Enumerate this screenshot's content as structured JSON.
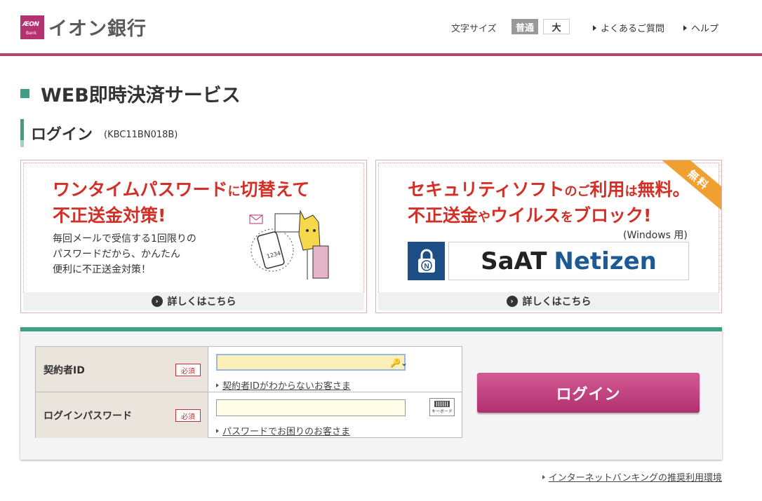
{
  "header": {
    "logo_small": "ÆON",
    "logo_bank": "Bank",
    "logo_text": "イオン銀行",
    "font_size_label": "文字サイズ",
    "font_normal": "普通",
    "font_large": "大",
    "faq": "よくあるご質問",
    "help": "ヘルプ"
  },
  "page_title": "WEB即時決済サービス",
  "login_section": {
    "title": "ログイン",
    "code": "(KBC11BN018B)"
  },
  "banner_otp": {
    "headline_line1_part1": "ワンタイムパスワード",
    "headline_line1_part2": "に",
    "headline_line1_part3": "切替えて",
    "headline_line2": "不正送金対策!",
    "body": [
      "毎回メールで受信する1回限りの",
      "パスワードだから、かんたん",
      "便利に不正送金対策！"
    ],
    "link": "詳しくはこちら"
  },
  "banner_security": {
    "ribbon": "無料",
    "line1_a": "セキュリティソフト",
    "line1_b": "のご",
    "line1_c": "利用",
    "line1_d": "は",
    "line1_e": "無料。",
    "line2_a": "不正送金",
    "line2_b": "や",
    "line2_c": "ウイルス",
    "line2_d": "を",
    "line2_e": "ブロック!",
    "windows_note": "(Windows 用)",
    "product_a": "SaAT",
    "product_b": "Netizen",
    "link": "詳しくはこちら"
  },
  "form": {
    "id_label": "契約者ID",
    "required": "必須",
    "id_value": "",
    "id_help": "契約者IDがわからないお客さま",
    "pw_label": "ログインパスワード",
    "pw_value": "",
    "pw_help": "パスワードでお困りのお客さま",
    "keyboard_label": "キーボード",
    "login_button": "ログイン"
  },
  "footer_link": "インターネットバンキングの推奨利用環境",
  "colors": {
    "brand": "#b4326f",
    "accent_green": "#3f9f86",
    "banner_red": "#d22f26",
    "ribbon_orange": "#f0a030"
  }
}
